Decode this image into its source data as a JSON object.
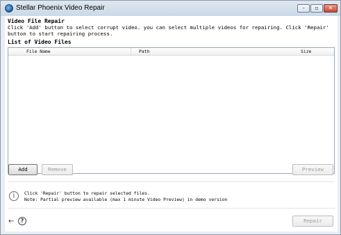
{
  "window": {
    "title": "Stellar Phoenix Video Repair",
    "controls": {
      "minimize": "–",
      "maximize": "▫",
      "close": "✕"
    }
  },
  "header": {
    "heading": "Video File Repair",
    "description": "Click 'Add' button to select corrupt video. you can select multiple videos for repairing. Click 'Repair' button to start repairing process."
  },
  "list": {
    "title": "List of Video Files",
    "columns": [
      "File Name",
      "Path",
      "Size"
    ],
    "rows": []
  },
  "buttons": {
    "add": "Add",
    "remove": "Remove",
    "preview": "Preview",
    "repair": "Repair"
  },
  "info": {
    "line1": "Click 'Repair' button to repair selected files.",
    "line2": "Note: Partial preview available (max 1 minute Video Preview) in demo version"
  },
  "footer": {
    "back_icon": "back-arrow-icon",
    "help_icon": "help-icon"
  }
}
